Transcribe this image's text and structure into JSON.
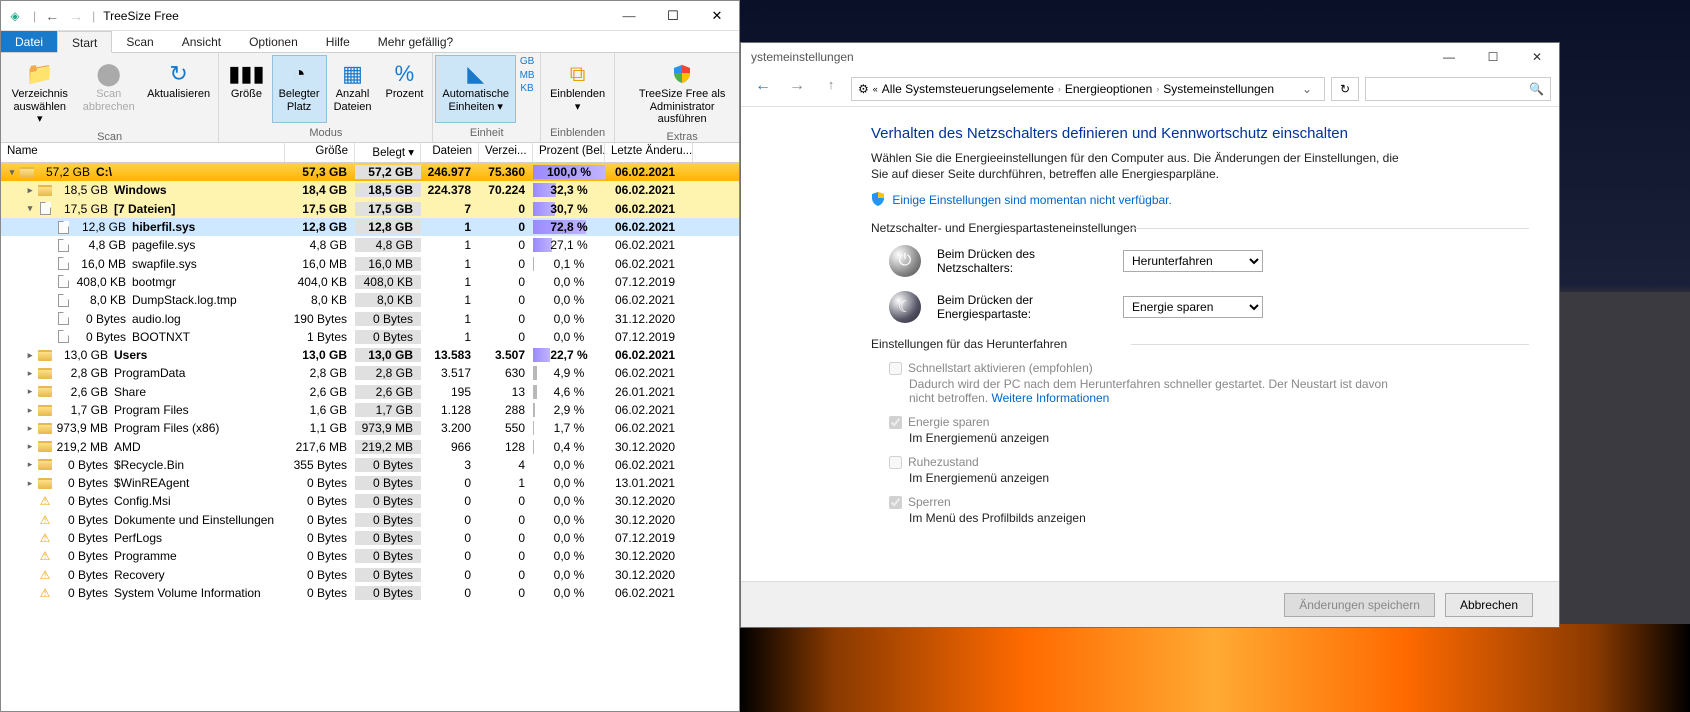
{
  "treesize": {
    "title": "TreeSize Free",
    "tabs": {
      "file": "Datei",
      "start": "Start",
      "scan": "Scan",
      "view": "Ansicht",
      "options": "Optionen",
      "help": "Hilfe",
      "more": "Mehr gefällig?"
    },
    "ribbon": {
      "g1": {
        "label": "Scan",
        "b1": "Verzeichnis\nauswählen ▾",
        "b2": "Scan\nabbrechen",
        "b3": "Aktualisieren"
      },
      "g2": {
        "label": "Modus",
        "b1": "Größe",
        "b2": "Belegter\nPlatz",
        "b3": "Anzahl\nDateien",
        "b4": "Prozent"
      },
      "g3": {
        "label": "Einheit",
        "b1": "Automatische\nEinheiten ▾",
        "u1": "GB",
        "u2": "MB",
        "u3": "KB"
      },
      "g4": {
        "label": "Einblenden",
        "b1": "Einblenden\n▾"
      },
      "g5": {
        "label": "Extras",
        "b1": "TreeSize Free als\nAdministrator ausführen"
      }
    },
    "columns": {
      "name": "Name",
      "size": "Größe",
      "occ": "Belegt ▾",
      "files": "Dateien",
      "dirs": "Verzei...",
      "pct": "Prozent (Bel...",
      "date": "Letzte Änderu..."
    },
    "rows": [
      {
        "lvl": 0,
        "exp": "▾",
        "ico": "f",
        "bold": 1,
        "style": "lvl0",
        "sz": "57,2 GB",
        "nm": "C:\\",
        "size": "57,3 GB",
        "occ": "57,2 GB",
        "fil": "246.977",
        "dir": "75.360",
        "pct": "100,0 %",
        "pw": 100,
        "date": "06.02.2021"
      },
      {
        "lvl": 1,
        "exp": "▸",
        "ico": "f",
        "bold": 1,
        "style": "lvl1",
        "sz": "18,5 GB",
        "nm": "Windows",
        "size": "18,4 GB",
        "occ": "18,5 GB",
        "fil": "224.378",
        "dir": "70.224",
        "pct": "32,3 %",
        "pw": 32,
        "date": "06.02.2021"
      },
      {
        "lvl": 1,
        "exp": "▾",
        "ico": "d",
        "bold": 1,
        "style": "lvl1",
        "sz": "17,5 GB",
        "nm": "[7 Dateien]",
        "size": "17,5 GB",
        "occ": "17,5 GB",
        "fil": "7",
        "dir": "0",
        "pct": "30,7 %",
        "pw": 31,
        "date": "06.02.2021"
      },
      {
        "lvl": 2,
        "exp": "",
        "ico": "d",
        "bold": 1,
        "style": "sel",
        "sz": "12,8 GB",
        "nm": "hiberfil.sys",
        "size": "12,8 GB",
        "occ": "12,8 GB",
        "fil": "1",
        "dir": "0",
        "pct": "72,8 %",
        "pw": 73,
        "date": "06.02.2021"
      },
      {
        "lvl": 2,
        "exp": "",
        "ico": "d",
        "sz": "4,8 GB",
        "nm": "pagefile.sys",
        "size": "4,8 GB",
        "occ": "4,8 GB",
        "fil": "1",
        "dir": "0",
        "pct": "27,1 %",
        "pw": 27,
        "date": "06.02.2021"
      },
      {
        "lvl": 2,
        "exp": "",
        "ico": "d",
        "sz": "16,0 MB",
        "nm": "swapfile.sys",
        "size": "16,0 MB",
        "occ": "16,0 MB",
        "fil": "1",
        "dir": "0",
        "pct": "0,1 %",
        "pw": 1,
        "gray": 1,
        "date": "06.02.2021"
      },
      {
        "lvl": 2,
        "exp": "",
        "ico": "d",
        "sz": "408,0 KB",
        "nm": "bootmgr",
        "size": "404,0 KB",
        "occ": "408,0 KB",
        "fil": "1",
        "dir": "0",
        "pct": "0,0 %",
        "pw": 0,
        "gray": 1,
        "date": "07.12.2019"
      },
      {
        "lvl": 2,
        "exp": "",
        "ico": "d",
        "sz": "8,0 KB",
        "nm": "DumpStack.log.tmp",
        "size": "8,0 KB",
        "occ": "8,0 KB",
        "fil": "1",
        "dir": "0",
        "pct": "0,0 %",
        "pw": 0,
        "gray": 1,
        "date": "06.02.2021"
      },
      {
        "lvl": 2,
        "exp": "",
        "ico": "d",
        "sz": "0 Bytes",
        "nm": "audio.log",
        "size": "190 Bytes",
        "occ": "0 Bytes",
        "fil": "1",
        "dir": "0",
        "pct": "0,0 %",
        "pw": 0,
        "gray": 1,
        "date": "31.12.2020"
      },
      {
        "lvl": 2,
        "exp": "",
        "ico": "d",
        "sz": "0 Bytes",
        "nm": "BOOTNXT",
        "size": "1 Bytes",
        "occ": "0 Bytes",
        "fil": "1",
        "dir": "0",
        "pct": "0,0 %",
        "pw": 0,
        "gray": 1,
        "date": "07.12.2019"
      },
      {
        "lvl": 1,
        "exp": "▸",
        "ico": "f",
        "bold": 1,
        "sz": "13,0 GB",
        "nm": "Users",
        "size": "13,0 GB",
        "occ": "13,0 GB",
        "fil": "13.583",
        "dir": "3.507",
        "pct": "22,7 %",
        "pw": 23,
        "date": "06.02.2021"
      },
      {
        "lvl": 1,
        "exp": "▸",
        "ico": "f",
        "sz": "2,8 GB",
        "nm": "ProgramData",
        "size": "2,8 GB",
        "occ": "2,8 GB",
        "fil": "3.517",
        "dir": "630",
        "pct": "4,9 %",
        "pw": 5,
        "gray": 1,
        "date": "06.02.2021"
      },
      {
        "lvl": 1,
        "exp": "▸",
        "ico": "f",
        "sz": "2,6 GB",
        "nm": "Share",
        "size": "2,6 GB",
        "occ": "2,6 GB",
        "fil": "195",
        "dir": "13",
        "pct": "4,6 %",
        "pw": 5,
        "gray": 1,
        "date": "26.01.2021"
      },
      {
        "lvl": 1,
        "exp": "▸",
        "ico": "f",
        "sz": "1,7 GB",
        "nm": "Program Files",
        "size": "1,6 GB",
        "occ": "1,7 GB",
        "fil": "1.128",
        "dir": "288",
        "pct": "2,9 %",
        "pw": 3,
        "gray": 1,
        "date": "06.02.2021"
      },
      {
        "lvl": 1,
        "exp": "▸",
        "ico": "f",
        "sz": "973,9 MB",
        "nm": "Program Files (x86)",
        "size": "1,1 GB",
        "occ": "973,9 MB",
        "fil": "3.200",
        "dir": "550",
        "pct": "1,7 %",
        "pw": 2,
        "gray": 1,
        "date": "06.02.2021"
      },
      {
        "lvl": 1,
        "exp": "▸",
        "ico": "f",
        "sz": "219,2 MB",
        "nm": "AMD",
        "size": "217,6 MB",
        "occ": "219,2 MB",
        "fil": "966",
        "dir": "128",
        "pct": "0,4 %",
        "pw": 1,
        "gray": 1,
        "date": "30.12.2020"
      },
      {
        "lvl": 1,
        "exp": "▸",
        "ico": "f",
        "sz": "0 Bytes",
        "nm": "$Recycle.Bin",
        "size": "355 Bytes",
        "occ": "0 Bytes",
        "fil": "3",
        "dir": "4",
        "pct": "0,0 %",
        "pw": 0,
        "gray": 1,
        "date": "06.02.2021"
      },
      {
        "lvl": 1,
        "exp": "▸",
        "ico": "f",
        "sz": "0 Bytes",
        "nm": "$WinREAgent",
        "size": "0 Bytes",
        "occ": "0 Bytes",
        "fil": "0",
        "dir": "1",
        "pct": "0,0 %",
        "pw": 0,
        "gray": 1,
        "date": "13.01.2021"
      },
      {
        "lvl": 1,
        "exp": "",
        "ico": "w",
        "sz": "0 Bytes",
        "nm": "Config.Msi",
        "size": "0 Bytes",
        "occ": "0 Bytes",
        "fil": "0",
        "dir": "0",
        "pct": "0,0 %",
        "pw": 0,
        "gray": 1,
        "date": "30.12.2020"
      },
      {
        "lvl": 1,
        "exp": "",
        "ico": "w",
        "sz": "0 Bytes",
        "nm": "Dokumente und Einstellungen",
        "size": "0 Bytes",
        "occ": "0 Bytes",
        "fil": "0",
        "dir": "0",
        "pct": "0,0 %",
        "pw": 0,
        "gray": 1,
        "date": "30.12.2020"
      },
      {
        "lvl": 1,
        "exp": "",
        "ico": "w",
        "sz": "0 Bytes",
        "nm": "PerfLogs",
        "size": "0 Bytes",
        "occ": "0 Bytes",
        "fil": "0",
        "dir": "0",
        "pct": "0,0 %",
        "pw": 0,
        "gray": 1,
        "date": "07.12.2019"
      },
      {
        "lvl": 1,
        "exp": "",
        "ico": "w",
        "sz": "0 Bytes",
        "nm": "Programme",
        "size": "0 Bytes",
        "occ": "0 Bytes",
        "fil": "0",
        "dir": "0",
        "pct": "0,0 %",
        "pw": 0,
        "gray": 1,
        "date": "30.12.2020"
      },
      {
        "lvl": 1,
        "exp": "",
        "ico": "w",
        "sz": "0 Bytes",
        "nm": "Recovery",
        "size": "0 Bytes",
        "occ": "0 Bytes",
        "fil": "0",
        "dir": "0",
        "pct": "0,0 %",
        "pw": 0,
        "gray": 1,
        "date": "30.12.2020"
      },
      {
        "lvl": 1,
        "exp": "",
        "ico": "w",
        "sz": "0 Bytes",
        "nm": "System Volume Information",
        "size": "0 Bytes",
        "occ": "0 Bytes",
        "fil": "0",
        "dir": "0",
        "pct": "0,0 %",
        "pw": 0,
        "gray": 1,
        "date": "06.02.2021"
      }
    ]
  },
  "settings": {
    "wintitle": "ystemeinstellungen",
    "bread": {
      "b1": "Alle Systemsteuerungselemente",
      "b2": "Energieoptionen",
      "b3": "Systemeinstellungen"
    },
    "h1": "Verhalten des Netzschalters definieren und Kennwortschutz einschalten",
    "p1": "Wählen Sie die Energieeinstellungen für den Computer aus. Die Änderungen der Einstellungen, die Sie auf dieser Seite durchführen, betreffen alle Energiesparpläne.",
    "admin_link": "Einige Einstellungen sind momentan nicht verfügbar.",
    "sec1": "Netzschalter- und Energiespartasteneinstellungen",
    "opt1_label": "Beim Drücken des Netzschalters:",
    "opt1_val": "Herunterfahren",
    "opt2_label": "Beim Drücken der Energiespartaste:",
    "opt2_val": "Energie sparen",
    "sec2": "Einstellungen für das Herunterfahren",
    "c1": "Schnellstart aktivieren (empfohlen)",
    "c1_sub_a": "Dadurch wird der PC nach dem Herunterfahren schneller gestartet. Der Neustart ist davon nicht betroffen. ",
    "c1_sub_link": "Weitere Informationen",
    "c2": "Energie sparen",
    "c2_sub": "Im Energiemenü anzeigen",
    "c3": "Ruhezustand",
    "c3_sub": "Im Energiemenü anzeigen",
    "c4": "Sperren",
    "c4_sub": "Im Menü des Profilbilds anzeigen",
    "btn_save": "Änderungen speichern",
    "btn_cancel": "Abbrechen"
  }
}
